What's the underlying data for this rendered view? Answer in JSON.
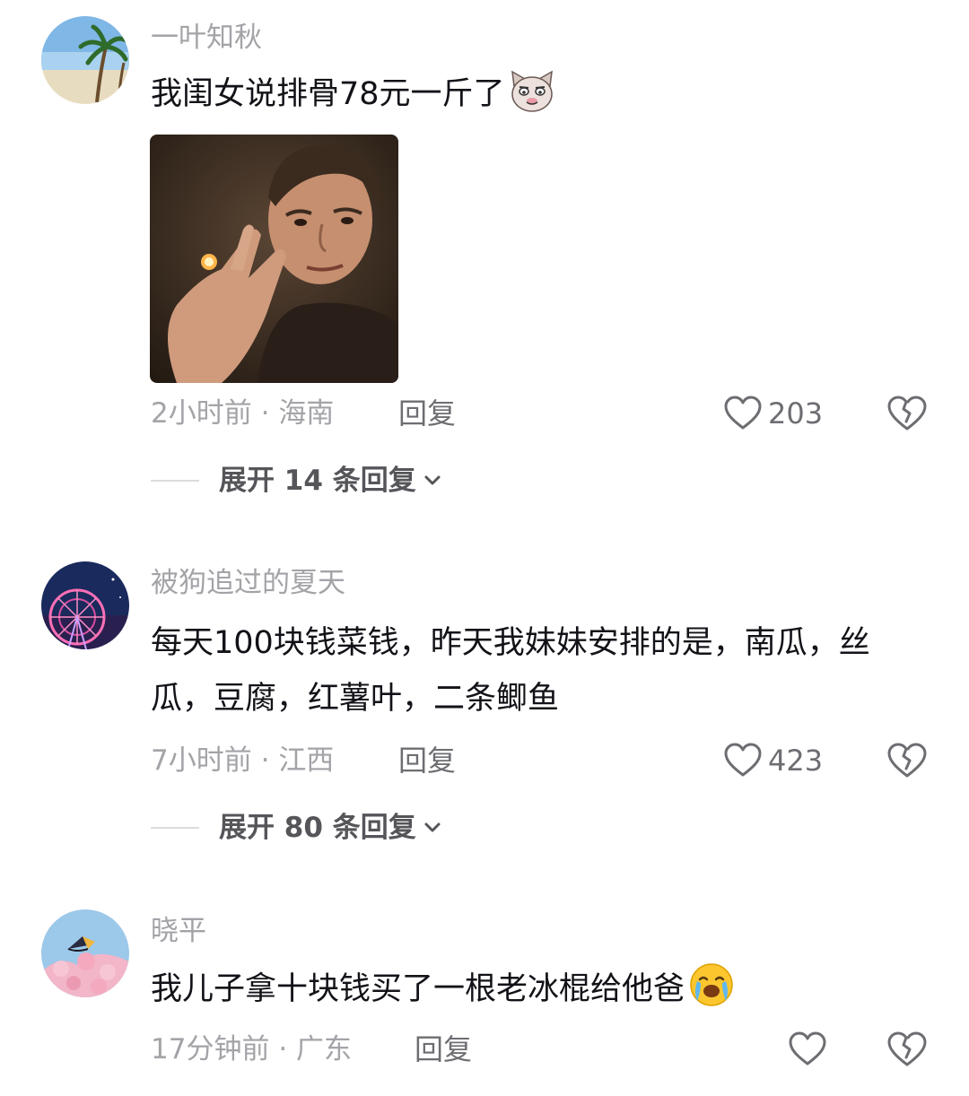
{
  "comments": [
    {
      "username": "一叶知秋",
      "text": "我闺女说排骨78元一斤了",
      "emoji": "cat-face-emoji",
      "has_image": true,
      "time": "2小时前",
      "location": "海南",
      "meta_separator": "·",
      "reply_label": "回复",
      "likes": "203",
      "expand_label": "展开 14 条回复"
    },
    {
      "username": "被狗追过的夏天",
      "text": "每天100块钱菜钱，昨天我妹妹安排的是，南瓜，丝瓜，豆腐，红薯叶，二条鲫鱼",
      "time": "7小时前",
      "location": "江西",
      "meta_separator": "·",
      "reply_label": "回复",
      "likes": "423",
      "expand_label": "展开 80 条回复"
    },
    {
      "username": "晓平",
      "text": "我儿子拿十块钱买了一根老冰棍给他爸",
      "emoji": "crying-face-emoji",
      "time": "17分钟前",
      "location": "广东",
      "meta_separator": "·",
      "reply_label": "回复"
    }
  ],
  "icons": [
    "heart-icon",
    "broken-heart-icon",
    "chevron-down-icon"
  ],
  "colors": {
    "text": "#121218",
    "muted": "#a3a3a8",
    "action": "#6d6d72"
  }
}
